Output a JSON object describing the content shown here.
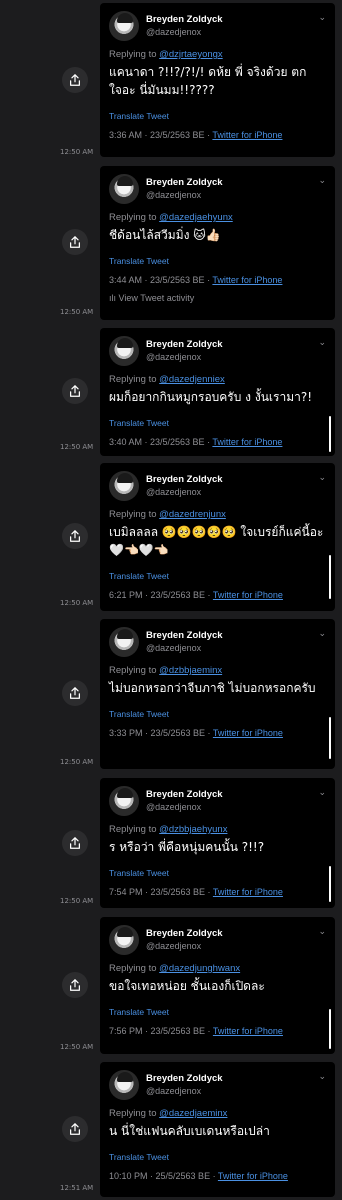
{
  "translate_label": "Translate Tweet",
  "activity_label": "View Tweet activity",
  "tweets": [
    {
      "name": "Breyden Zoldyck",
      "handle": "@dazedjenox",
      "reply_prefix": "Replying to ",
      "reply_to": "@dzjrtaeyongx",
      "text": "แคนาดา ?!!?/?!/! ดห้ย พี่ จริงด้วย ตกใจอะ นี่มันมม!!????",
      "time": "3:36 AM · 23/5/2563 BE · ",
      "source": "Twitter for iPhone",
      "side_time": "12:50 AM"
    },
    {
      "name": "Breyden Zoldyck",
      "handle": "@dazedjenox",
      "reply_prefix": "Replying to ",
      "reply_to": "@dazedjaehyunx",
      "text": "ชีด้อนไล้สวีมมิ่ง 🐱👍🏻",
      "time": "3:44 AM · 23/5/2563 BE · ",
      "source": "Twitter for iPhone",
      "side_time": "12:50 AM"
    },
    {
      "name": "Breyden Zoldyck",
      "handle": "@dazedjenox",
      "reply_prefix": "Replying to ",
      "reply_to": "@dazedjenniex",
      "text": "ผมก็อยากกินหมูกรอบครับ ง งั้นเรามา?!",
      "time": "3:40 AM · 23/5/2563 BE · ",
      "source": "Twitter for iPhone",
      "side_time": "12:50 AM"
    },
    {
      "name": "Breyden Zoldyck",
      "handle": "@dazedjenox",
      "reply_prefix": "Replying to ",
      "reply_to": "@dazedrenjunx",
      "text": "เบมิลลลล 🥺🥺🥺🥺🥺 ใจเบรย์ก็แค่นี้อะ 🤍👈🏻🤍👈🏻",
      "time": "6:21 PM · 23/5/2563 BE · ",
      "source": "Twitter for iPhone",
      "side_time": "12:50 AM"
    },
    {
      "name": "Breyden Zoldyck",
      "handle": "@dazedjenox",
      "reply_prefix": "Replying to ",
      "reply_to": "@dzbbjaeminx",
      "text": "ไม่บอกหรอกว่าจีบภาชิ ไม่บอกหรอกครับ",
      "time": "3:33 PM · 23/5/2563 BE · ",
      "source": "Twitter for iPhone",
      "side_time": "12:50 AM"
    },
    {
      "name": "Breyden Zoldyck",
      "handle": "@dazedjenox",
      "reply_prefix": "Replying to ",
      "reply_to": "@dzbbjaehyunx",
      "text": "ร หรือว่า พี่คือหนุ่มคนนั้น ?!!?",
      "time": "7:54 PM · 23/5/2563 BE · ",
      "source": "Twitter for iPhone",
      "side_time": "12:50 AM"
    },
    {
      "name": "Breyden Zoldyck",
      "handle": "@dazedjenox",
      "reply_prefix": "Replying to ",
      "reply_to": "@dazedjunghwanx",
      "text": "ขอใจเทอหน่อย ชั้นเองก็เปิดละ",
      "time": "7:56 PM · 23/5/2563 BE · ",
      "source": "Twitter for iPhone",
      "side_time": "12:50 AM"
    },
    {
      "name": "Breyden Zoldyck",
      "handle": "@dazedjenox",
      "reply_prefix": "Replying to ",
      "reply_to": "@dazedjaeminx",
      "text": "น นี่ใช่แฟนคลับเบเดนหรือเปล่า",
      "time": "10:10 PM · 25/5/2563 BE · ",
      "source": "Twitter for iPhone",
      "side_time": "12:51 AM"
    }
  ]
}
